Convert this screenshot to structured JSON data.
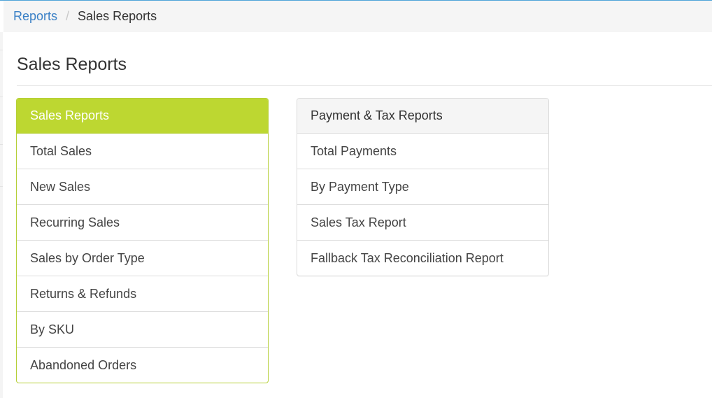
{
  "breadcrumb": {
    "root_label": "Reports",
    "separator": "/",
    "current_label": "Sales Reports"
  },
  "page": {
    "title": "Sales Reports"
  },
  "sales_panel": {
    "heading": "Sales Reports",
    "accent_color": "#bdd731",
    "items": [
      {
        "label": "Total Sales"
      },
      {
        "label": "New Sales"
      },
      {
        "label": "Recurring Sales"
      },
      {
        "label": "Sales by Order Type"
      },
      {
        "label": "Returns & Refunds"
      },
      {
        "label": "By SKU"
      },
      {
        "label": "Abandoned Orders"
      }
    ]
  },
  "payment_panel": {
    "heading": "Payment & Tax Reports",
    "items": [
      {
        "label": "Total Payments"
      },
      {
        "label": "By Payment Type"
      },
      {
        "label": "Sales Tax Report"
      },
      {
        "label": "Fallback Tax Reconciliation Report"
      }
    ]
  }
}
